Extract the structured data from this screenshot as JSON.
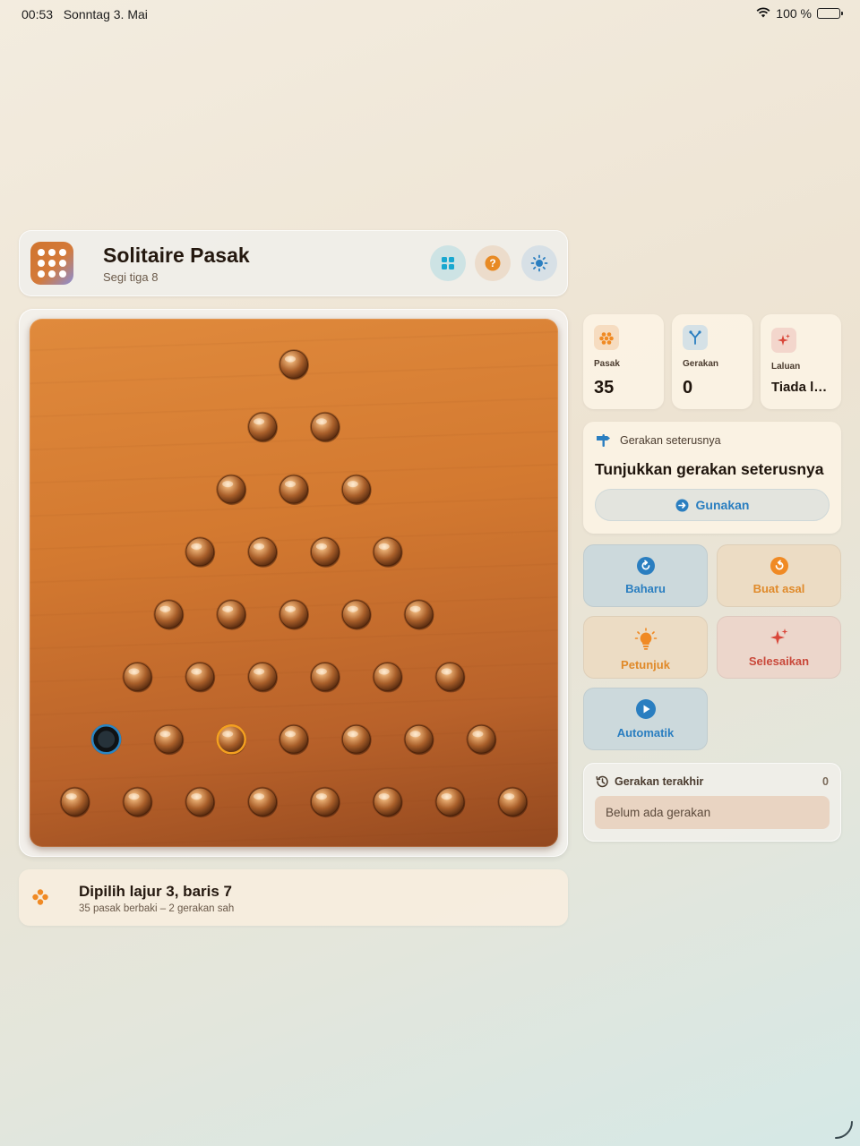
{
  "status_bar": {
    "time": "00:53",
    "date": "Sonntag 3. Mai",
    "battery": "100 %"
  },
  "header": {
    "title": "Solitaire Pasak",
    "subtitle": "Segi tiga 8"
  },
  "board": {
    "rows": 8,
    "empty_hole": {
      "row": 7,
      "col": 1
    },
    "selected_peg": {
      "row": 7,
      "col": 3
    }
  },
  "status": {
    "title": "Dipilih lajur 3, baris 7",
    "subtitle": "35 pasak berbaki – 2 gerakan sah"
  },
  "stats": [
    {
      "label": "Pasak",
      "value": "35",
      "icon": "peg-cluster-icon",
      "color": "#f08a24"
    },
    {
      "label": "Gerakan",
      "value": "0",
      "icon": "branch-icon",
      "color": "#2a7ec0"
    },
    {
      "label": "Laluan",
      "value": "Tiada l…",
      "icon": "sparkle-icon",
      "color": "#d9473a"
    }
  ],
  "next_move": {
    "heading": "Gerakan seterusnya",
    "title": "Tunjukkan gerakan seterusnya",
    "button": "Gunakan"
  },
  "actions": {
    "reset": "Baharu",
    "undo": "Buat asal",
    "hint": "Petunjuk",
    "solve": "Selesaikan",
    "auto": "Automatik"
  },
  "recent": {
    "title": "Gerakan terakhir",
    "count": "0",
    "empty": "Belum ada gerakan"
  },
  "colors": {
    "accent_blue": "#2a7ec0",
    "accent_orange": "#e08a2a",
    "accent_red": "#c9483a",
    "board": "#d37930"
  }
}
